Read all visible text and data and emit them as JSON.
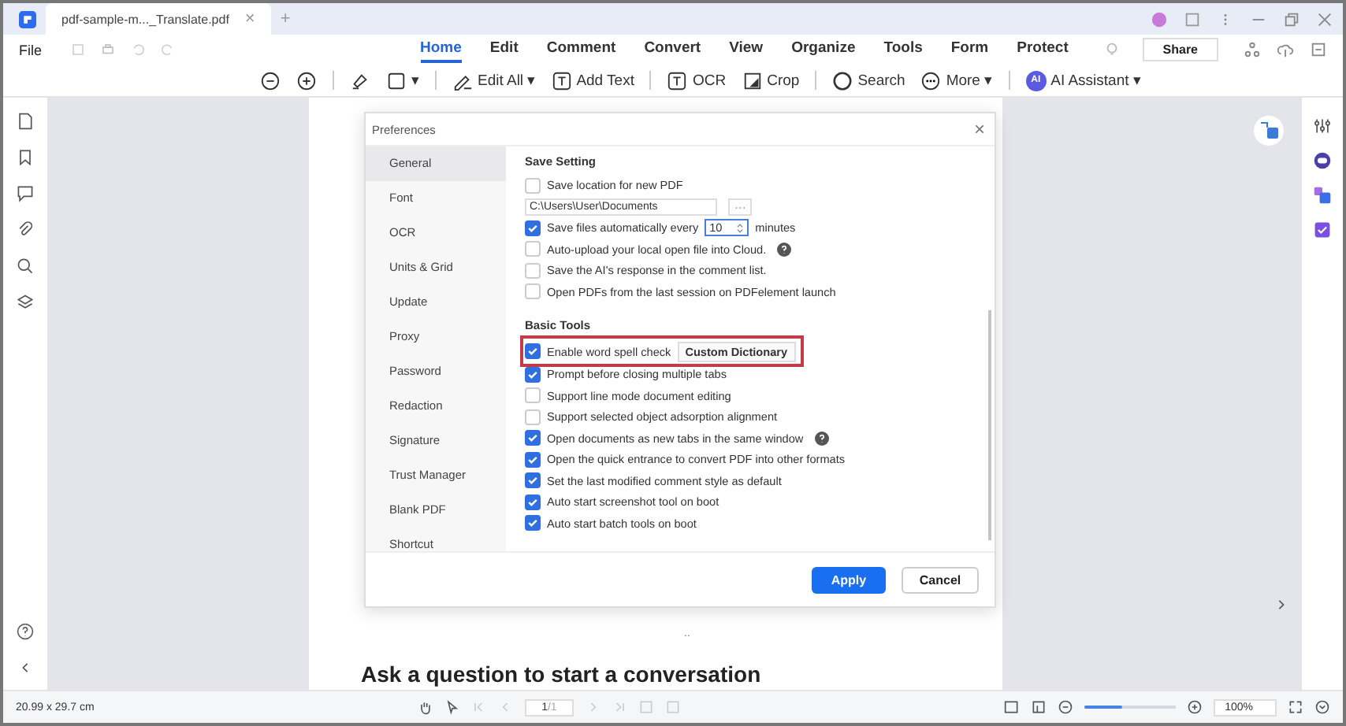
{
  "tab": {
    "title": "pdf-sample-m..._Translate.pdf",
    "close": "×",
    "new": "+"
  },
  "menu": {
    "file": "File",
    "items": [
      {
        "label": "Home",
        "selected": true
      },
      {
        "label": "Edit",
        "selected": false
      },
      {
        "label": "Comment",
        "selected": false
      },
      {
        "label": "Convert",
        "selected": false
      },
      {
        "label": "View",
        "selected": false
      },
      {
        "label": "Organize",
        "selected": false
      },
      {
        "label": "Tools",
        "selected": false
      },
      {
        "label": "Form",
        "selected": false
      },
      {
        "label": "Protect",
        "selected": false
      }
    ],
    "share": "Share"
  },
  "toolbar": [
    {
      "kind": "zoom-out"
    },
    {
      "kind": "zoom-in"
    },
    {
      "kind": "sep"
    },
    {
      "kind": "highlighter"
    },
    {
      "kind": "shape",
      "label": "▾"
    },
    {
      "kind": "sep"
    },
    {
      "kind": "edit-all",
      "label": "Edit All ▾"
    },
    {
      "kind": "add-text",
      "label": "Add Text"
    },
    {
      "kind": "sep"
    },
    {
      "kind": "ocr",
      "label": "OCR"
    },
    {
      "kind": "crop",
      "label": "Crop"
    },
    {
      "kind": "sep"
    },
    {
      "kind": "search",
      "label": "Search"
    },
    {
      "kind": "more",
      "label": "More ▾"
    },
    {
      "kind": "sep"
    },
    {
      "kind": "ai",
      "label": "AI Assistant ▾",
      "badge": "AI"
    }
  ],
  "dialog": {
    "title": "Preferences",
    "close": "×",
    "nav": [
      {
        "label": "General",
        "selected": true
      },
      {
        "label": "Font",
        "selected": false
      },
      {
        "label": "OCR",
        "selected": false
      },
      {
        "label": "Units & Grid",
        "selected": false
      },
      {
        "label": "Update",
        "selected": false
      },
      {
        "label": "Proxy",
        "selected": false
      },
      {
        "label": "Password",
        "selected": false
      },
      {
        "label": "Redaction",
        "selected": false
      },
      {
        "label": "Signature",
        "selected": false
      },
      {
        "label": "Trust Manager",
        "selected": false
      },
      {
        "label": "Blank PDF",
        "selected": false
      },
      {
        "label": "Shortcut",
        "selected": false
      }
    ],
    "save_setting": {
      "heading": "Save Setting",
      "items": [
        {
          "kind": "check",
          "label": "Save location for new PDF",
          "checked": false
        },
        {
          "kind": "path",
          "value": "C:\\Users\\User\\Documents",
          "button": "···"
        },
        {
          "kind": "autosave",
          "label": "Save files automatically every",
          "checked": true,
          "value": "10",
          "suffix": "minutes"
        },
        {
          "kind": "check",
          "label": "Auto-upload your local open file into Cloud.",
          "checked": false,
          "help": true
        },
        {
          "kind": "check",
          "label": "Save the AI's response in the comment list.",
          "checked": false
        },
        {
          "kind": "check",
          "label": "Open PDFs from the last session on PDFelement launch",
          "checked": false
        }
      ]
    },
    "basic_tools": {
      "heading": "Basic Tools",
      "items": [
        {
          "kind": "check",
          "label": "Enable word spell check",
          "checked": true,
          "button": "Custom Dictionary",
          "highlighted": true
        },
        {
          "kind": "check",
          "label": "Prompt before closing multiple tabs",
          "checked": true
        },
        {
          "kind": "check",
          "label": "Support line mode document editing",
          "checked": false
        },
        {
          "kind": "check",
          "label": "Support selected object adsorption alignment",
          "checked": false
        },
        {
          "kind": "check",
          "label": "Open documents as new tabs in the same window",
          "checked": true,
          "help": true
        },
        {
          "kind": "check",
          "label": "Open the quick entrance to convert PDF into other formats",
          "checked": true
        },
        {
          "kind": "check",
          "label": "Set the last modified comment style as default",
          "checked": true
        },
        {
          "kind": "check",
          "label": "Auto start screenshot tool on boot",
          "checked": true
        },
        {
          "kind": "check",
          "label": "Auto start batch tools on boot",
          "checked": true
        }
      ]
    },
    "apply": "Apply",
    "cancel": "Cancel"
  },
  "document": {
    "dots": "..",
    "heading": "Ask a question to start a conversation"
  },
  "status_bar": {
    "size": "20.99 x 29.7 cm",
    "page": "1",
    "total": "/1",
    "zoom_slider": {
      "level": 0.42
    },
    "zoom": "100%"
  }
}
